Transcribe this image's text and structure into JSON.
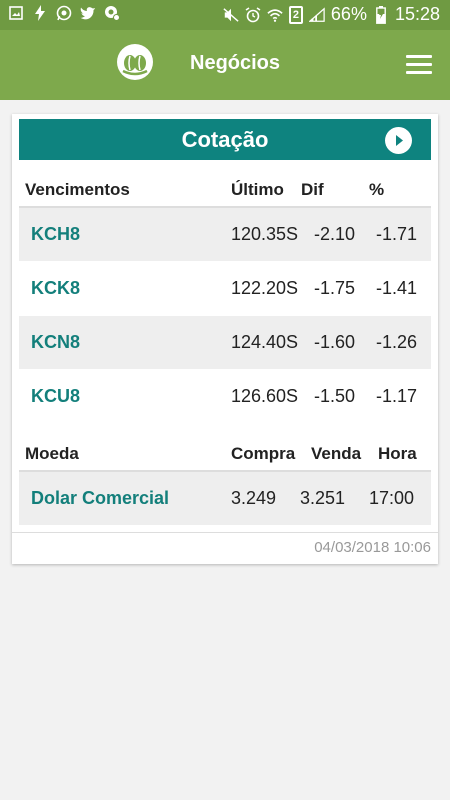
{
  "status_bar": {
    "battery": "66%",
    "time": "15:28",
    "sim_slot": "2"
  },
  "app_bar": {
    "title": "Negócios",
    "menu_icon": "hamburger-menu-icon",
    "logo_icon": "coffee-bean-logo-icon"
  },
  "card": {
    "title": "Cotação",
    "play_icon": "play-circle-icon"
  },
  "futures": {
    "headers": [
      "Vencimentos",
      "Último",
      "Dif",
      "%"
    ],
    "rows": [
      {
        "code": "KCH8",
        "last": "120.35S",
        "diff": "-2.10",
        "pct": "-1.71"
      },
      {
        "code": "KCK8",
        "last": "122.20S",
        "diff": "-1.75",
        "pct": "-1.41"
      },
      {
        "code": "KCN8",
        "last": "124.40S",
        "diff": "-1.60",
        "pct": "-1.26"
      },
      {
        "code": "KCU8",
        "last": "126.60S",
        "diff": "-1.50",
        "pct": "-1.17"
      }
    ]
  },
  "currency": {
    "headers": [
      "Moeda",
      "Compra",
      "Venda",
      "Hora"
    ],
    "rows": [
      {
        "name": "Dolar Comercial",
        "buy": "3.249",
        "sell": "3.251",
        "time": "17:00"
      }
    ]
  },
  "updated_at": "04/03/2018 10:06",
  "colors": {
    "status_bar": "#6f9a42",
    "app_bar": "#7ea94c",
    "header_teal": "#0e837f",
    "code_teal": "#137f7b"
  }
}
